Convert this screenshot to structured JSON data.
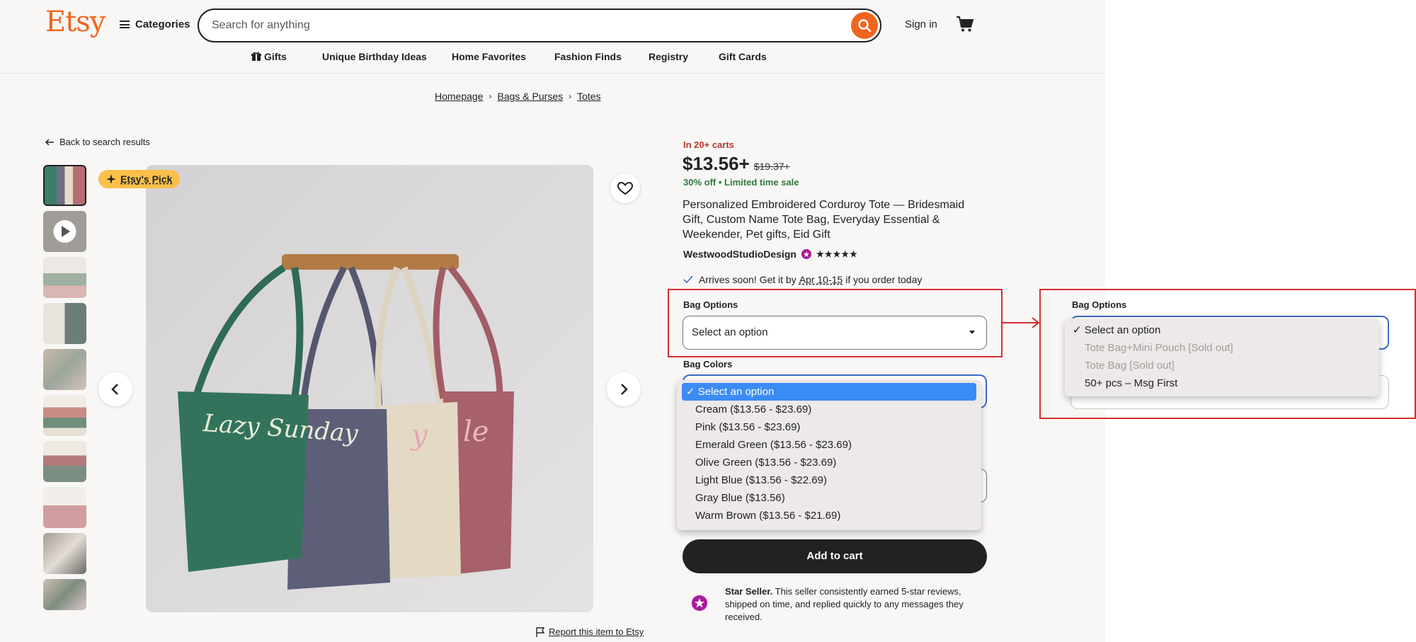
{
  "header": {
    "logo": "Etsy",
    "categories_label": "Categories",
    "search_placeholder": "Search for anything",
    "signin_label": "Sign in"
  },
  "nav": {
    "items": [
      "Gifts",
      "Unique Birthday Ideas",
      "Home Favorites",
      "Fashion Finds",
      "Registry",
      "Gift Cards"
    ]
  },
  "breadcrumb": [
    "Homepage",
    "Bags & Purses",
    "Totes"
  ],
  "back_label": "Back to search results",
  "badge": "Etsy's Pick",
  "report_label": "Report this item to Etsy",
  "product": {
    "in_carts": "In 20+ carts",
    "price": "$13.56+",
    "old_price": "$19.37+",
    "discount": "30% off",
    "sale_note": "Limited time sale",
    "title": "Personalized Embroidered Corduroy Tote — Bridesmaid Gift, Custom Name Tote Bag, Everyday Essential & Weekender, Pet gifts, Eid Gift",
    "shop": "WestwoodStudioDesign",
    "stars": "★★★★★",
    "arrives_prefix": "Arrives soon! Get it by",
    "arrives_date": "Apr 10-15",
    "arrives_suffix": "if you order today"
  },
  "bag_options": {
    "label": "Bag Options",
    "selected": "Select an option",
    "options": [
      "Select an option",
      "Tote Bag+Mini Pouch [Sold out]",
      "Tote Bag [Sold out]",
      "50+ pcs – Msg First"
    ]
  },
  "bag_colors": {
    "label": "Bag Colors",
    "options": [
      "Select an option",
      "Cream ($13.56 - $23.69)",
      "Pink ($13.56 - $23.69)",
      "Emerald Green ($13.56 - $23.69)",
      "Olive Green ($13.56 - $23.69)",
      "Light Blue ($13.56 - $22.69)",
      "Gray Blue ($13.56)",
      "Warm Brown ($13.56 - $21.69)"
    ]
  },
  "add_to_cart": "Add to cart",
  "star_seller": {
    "title": "Star Seller.",
    "text": "This seller consistently earned 5-star reviews, shipped on time, and replied quickly to any messages they received."
  },
  "colors": {
    "brand": "#f1641e",
    "annotation": "#d32f2f",
    "sale_green": "#2f7a3a",
    "carts_red": "#b7372f",
    "select_blue": "#3b8bf5"
  }
}
